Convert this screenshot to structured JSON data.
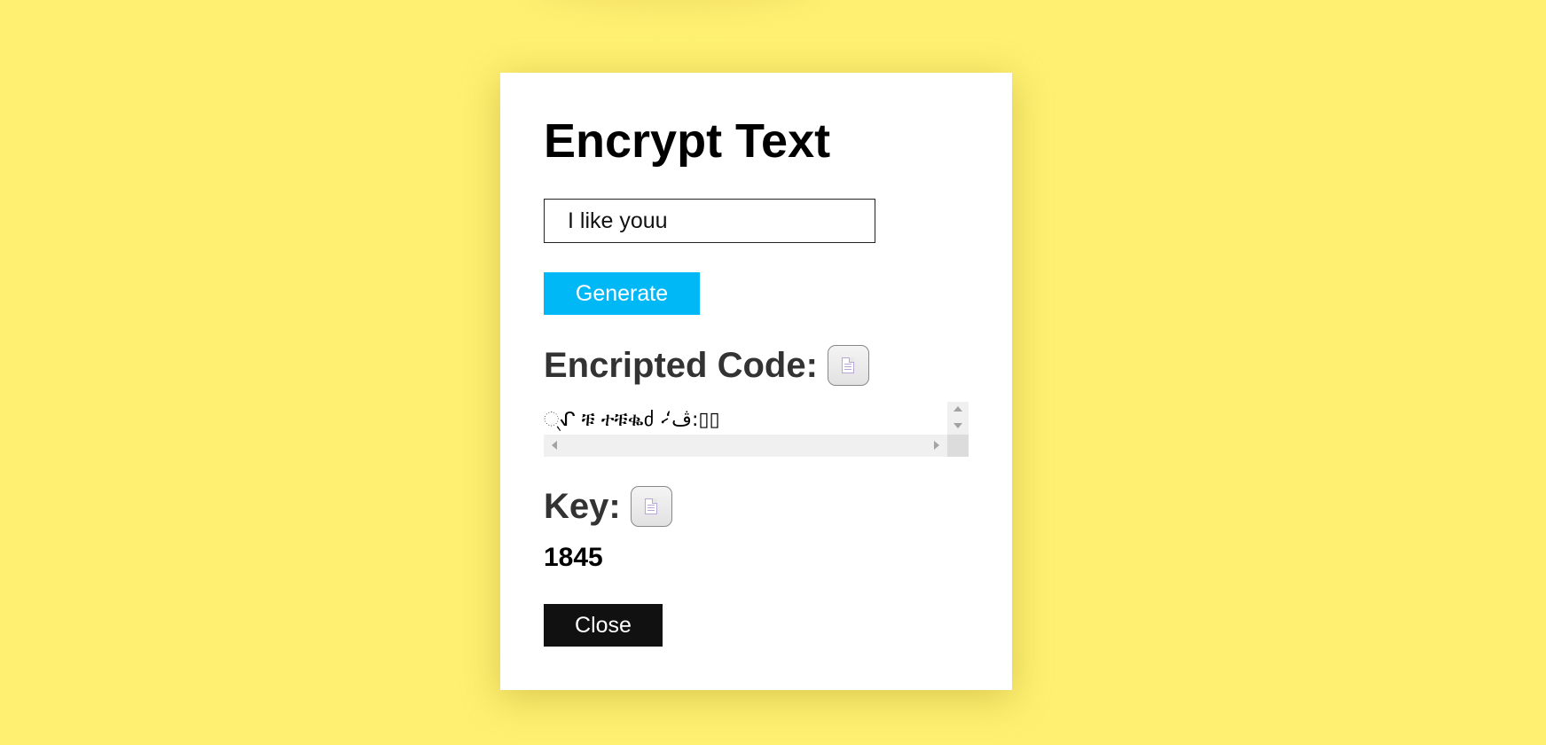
{
  "modal": {
    "title": "Encrypt Text",
    "input": {
      "value": "I like youu",
      "placeholder": ""
    },
    "generate_label": "Generate",
    "encrypted": {
      "heading": "Encripted Code:",
      "copy_icon": "copy-document-icon",
      "value": "୍ᖋ ቹ ተቹቈძ ⸳̷‘ڤ:▯▯"
    },
    "key": {
      "heading": "Key:",
      "copy_icon": "copy-document-icon",
      "value": "1845"
    },
    "close_label": "Close"
  },
  "colors": {
    "background": "#fff072",
    "generate_button": "#00b8f5",
    "close_button": "#111111",
    "modal": "#ffffff"
  }
}
